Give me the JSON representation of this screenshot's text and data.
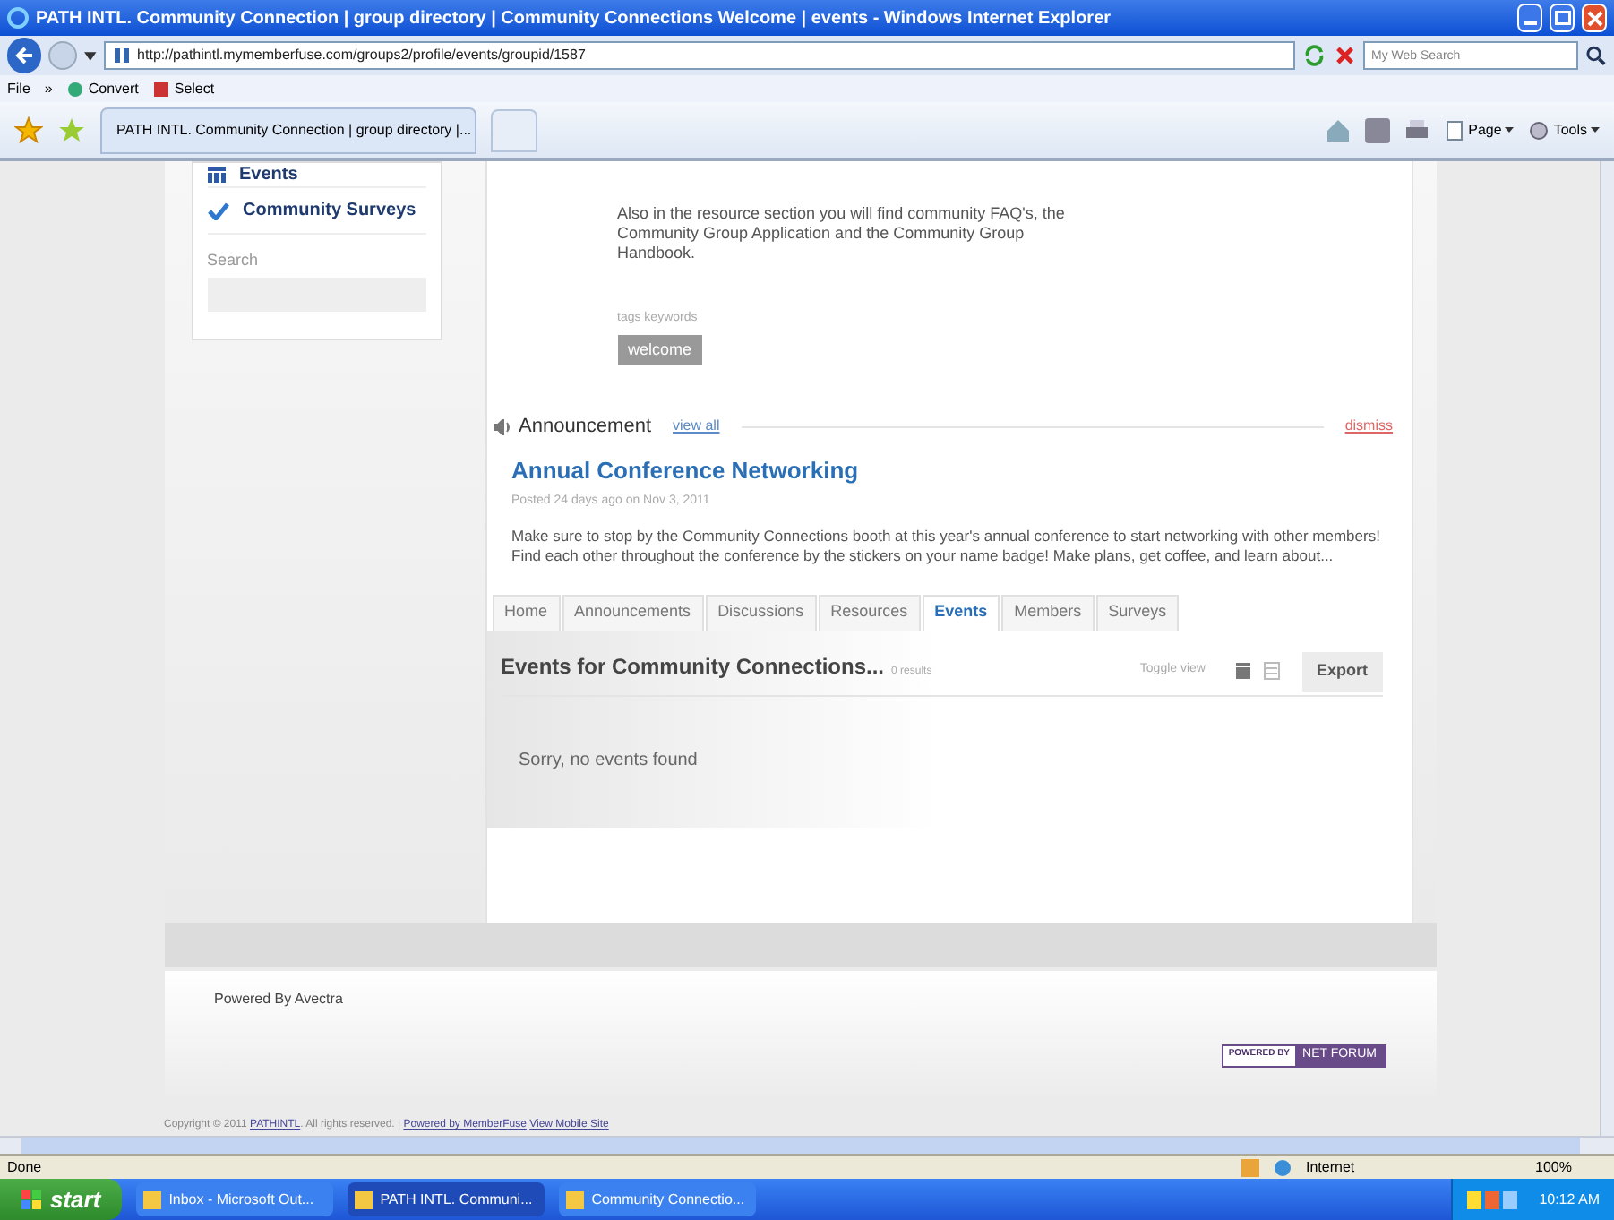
{
  "window": {
    "title": "PATH INTL. Community Connection | group directory | Community Connections Welcome | events - Windows Internet Explorer"
  },
  "address_bar": {
    "url": "http://pathintl.mymemberfuse.com/groups2/profile/events/groupid/1587",
    "search_placeholder": "My Web Search"
  },
  "command_bar": {
    "file": "File",
    "chevron": "»",
    "buttons": [
      "Convert",
      "Select"
    ]
  },
  "browser_tab": {
    "title": "PATH INTL. Community Connection | group directory |..."
  },
  "command_buttons": [
    {
      "label": "Page"
    },
    {
      "label": "Tools"
    }
  ],
  "sidebar": {
    "items": [
      {
        "label": "Events",
        "kind": "calendar"
      },
      {
        "label": "Community Surveys",
        "kind": "check"
      }
    ],
    "search_label": "Search"
  },
  "welcome": {
    "paragraph": "Also in the resource section you will find community FAQ's, the Community Group Application and the Community Group Handbook.",
    "tags_label": "tags keywords",
    "tags": [
      "welcome"
    ]
  },
  "announcement": {
    "heading": "Announcement",
    "view_all": "view all",
    "dismiss": "dismiss",
    "title": "Annual Conference Networking",
    "posted": "Posted 24 days ago on Nov 3, 2011",
    "body": "Make sure to stop by the Community Connections booth at this year's annual conference to start networking with other members! Find each other throughout the conference by the stickers on your name badge! Make plans, get coffee, and learn about..."
  },
  "tabs": [
    {
      "label": "Home",
      "selected": false
    },
    {
      "label": "Announcements",
      "selected": false
    },
    {
      "label": "Discussions",
      "selected": false
    },
    {
      "label": "Resources",
      "selected": false
    },
    {
      "label": "Events",
      "selected": true
    },
    {
      "label": "Members",
      "selected": false
    },
    {
      "label": "Surveys",
      "selected": false
    }
  ],
  "events": {
    "title": "Events for Community Connections...",
    "count": "0 results",
    "toggle_label": "Toggle view",
    "views": [
      {
        "kind": "calendar",
        "selected": true
      },
      {
        "kind": "list",
        "selected": false
      }
    ],
    "export": "Export",
    "empty_message": "Sorry, no events found"
  },
  "footer": {
    "powered": "Powered By Avectra",
    "badge_left": "POWERED BY",
    "badge_right": "NET FORUM",
    "copyright": "Copyright © 2011",
    "site_link": "PATHINTL",
    "rights": ". All rights reserved. |",
    "memberfuse_link": "Powered by MemberFuse",
    "mobile_link": "View Mobile Site"
  },
  "status_bar": {
    "status": "Done",
    "zone": "Internet",
    "zoom": "100%"
  },
  "taskbar": {
    "start": "start",
    "tasks": [
      {
        "label": "Inbox - Microsoft Out...",
        "selected": false
      },
      {
        "label": "PATH INTL. Communi...",
        "selected": true
      },
      {
        "label": "Community Connectio...",
        "selected": false
      }
    ],
    "clock": "10:12 AM"
  }
}
